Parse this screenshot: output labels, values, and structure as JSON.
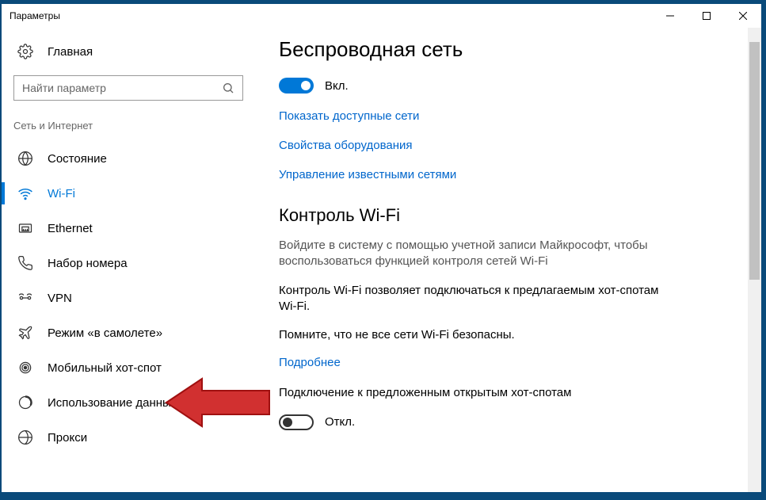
{
  "window": {
    "title": "Параметры"
  },
  "sidebar": {
    "home_label": "Главная",
    "search_placeholder": "Найти параметр",
    "section_title": "Сеть и Интернет",
    "items": [
      {
        "label": "Состояние"
      },
      {
        "label": "Wi-Fi"
      },
      {
        "label": "Ethernet"
      },
      {
        "label": "Набор номера"
      },
      {
        "label": "VPN"
      },
      {
        "label": "Режим «в самолете»"
      },
      {
        "label": "Мобильный хот-спот"
      },
      {
        "label": "Использование данных"
      },
      {
        "label": "Прокси"
      }
    ]
  },
  "content": {
    "heading1": "Беспроводная сеть",
    "toggle1_state": "Вкл.",
    "link1": "Показать доступные сети",
    "link2": "Свойства оборудования",
    "link3": "Управление известными сетями",
    "heading2": "Контроль Wi-Fi",
    "text1": "Войдите в систему с помощью учетной записи Майкрософт, чтобы воспользоваться функцией контроля сетей Wi-Fi",
    "text2": "Контроль Wi-Fi позволяет подключаться к предлагаемым хот-спотам Wi-Fi.",
    "text3": "Помните, что не все сети Wi-Fi безопасны.",
    "link4": "Подробнее",
    "text4": "Подключение к предложенным открытым хот-спотам",
    "toggle2_state": "Откл."
  }
}
